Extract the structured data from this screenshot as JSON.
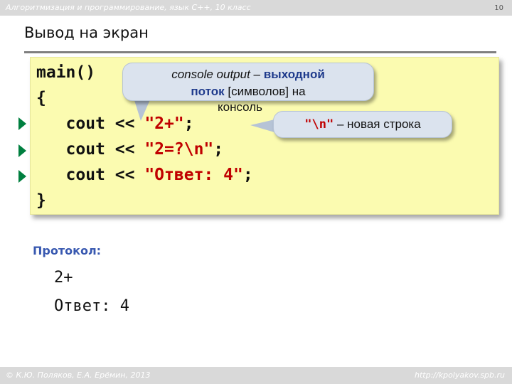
{
  "header": {
    "course": "Алгоритмизация и программирование, язык С++, 10 класс",
    "page_number": "10"
  },
  "slide": {
    "title": "Вывод на экран"
  },
  "code": {
    "line1": "main()",
    "line2": "{",
    "line3_prefix": "   cout << ",
    "line3_string": "\"2+\"",
    "line3_suffix": ";",
    "line4_prefix": "   cout << ",
    "line4_string": "\"2=?\\n\"",
    "line4_suffix": ";",
    "line5_prefix": "   cout << ",
    "line5_string": "\"Ответ: 4\"",
    "line5_suffix": ";",
    "line6": "}"
  },
  "callout_console": {
    "term": "console output",
    "dash": " – ",
    "bold1": "выходной",
    "bold2": "поток",
    "rest": " [символов] на",
    "rest2": "консоль"
  },
  "callout_newline": {
    "code": "\"\\n\"",
    "text": " – новая строка"
  },
  "protocol": {
    "label": "Протокол:",
    "line1": "2+",
    "line2": "Ответ: 4"
  },
  "footer": {
    "copyright": "© К.Ю. Поляков, Е.А. Ерёмин, 2013",
    "site": "http://kpolyakov.spb.ru"
  },
  "colors": {
    "code_background": "#fbfbb0",
    "string_literal": "#c00000",
    "callout_fill": "#dbe3ee",
    "accent_blue": "#1f3b8c",
    "marker_green": "#007f3f"
  }
}
